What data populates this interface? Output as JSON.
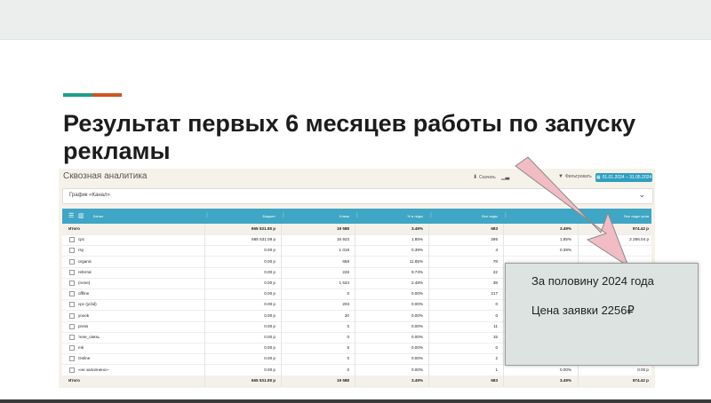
{
  "slide": {
    "title": "Результат первых 6 месяцев работы по запуску рекламы",
    "accent_colors": [
      "#1e9e86",
      "#d0541f"
    ]
  },
  "app": {
    "title": "Сквозная аналитика",
    "toolbar": {
      "download_label": "Скачать",
      "filter_label": "Фильтровать",
      "date_range": "01.01.2024 – 31.05.2024"
    },
    "chart_selector": "График «Канал»",
    "colors": {
      "header": "#3fa6c5",
      "date_button": "#2f9fc0",
      "total_row": "#f3f1ea"
    },
    "columns": [
      "Канал",
      "Бюджет",
      "Клики",
      "% в лиды",
      "Все лиды",
      "",
      "Все лиды цена"
    ],
    "rows": [
      {
        "channel": "Итого",
        "budget": "665 531.08 р",
        "clicks": "19 588",
        "conv": "3.49%",
        "leads": "683",
        "conv2": "3.49%",
        "price": "974.42 р",
        "total": true
      },
      {
        "channel": "cpc",
        "budget": "665 531.08 р",
        "clicks": "15 923",
        "conv": "1.85%",
        "leads": "295",
        "conv2": "1.85%",
        "price": "2 256.04 р"
      },
      {
        "channel": "rsy",
        "budget": "0.00 р",
        "clicks": "1 018",
        "conv": "0.39%",
        "leads": "4",
        "conv2": "0.39%",
        "price": ""
      },
      {
        "channel": "organic",
        "budget": "0.00 р",
        "clicks": "658",
        "conv": "11.85%",
        "leads": "78",
        "conv2": "",
        "price": ""
      },
      {
        "channel": "referral",
        "budget": "0.00 р",
        "clicks": "226",
        "conv": "9.73%",
        "leads": "22",
        "conv2": "",
        "price": ""
      },
      {
        "channel": "(none)",
        "budget": "0.00 р",
        "clicks": "1 534",
        "conv": "2.48%",
        "leads": "38",
        "conv2": "",
        "price": ""
      },
      {
        "channel": "offline",
        "budget": "0.00 р",
        "clicks": "0",
        "conv": "0.00%",
        "leads": "217",
        "conv2": "",
        "price": ""
      },
      {
        "channel": "cpc (yclid)",
        "budget": "0.00 р",
        "clicks": "203",
        "conv": "0.00%",
        "leads": "0",
        "conv2": "",
        "price": ""
      },
      {
        "channel": "yoxok",
        "budget": "0.00 р",
        "clicks": "20",
        "conv": "0.00%",
        "leads": "0",
        "conv2": "",
        "price": ""
      },
      {
        "channel": "press",
        "budget": "0.00 р",
        "clicks": "0",
        "conv": "0.00%",
        "leads": "11",
        "conv2": "",
        "price": ""
      },
      {
        "channel": "теле_связь",
        "budget": "0.00 р",
        "clicks": "0",
        "conv": "0.00%",
        "leads": "15",
        "conv2": "",
        "price": ""
      },
      {
        "channel": "mk",
        "budget": "0.00 р",
        "clicks": "6",
        "conv": "0.00%",
        "leads": "0",
        "conv2": "",
        "price": ""
      },
      {
        "channel": "Online",
        "budget": "0.00 р",
        "clicks": "0",
        "conv": "0.00%",
        "leads": "2",
        "conv2": "",
        "price": ""
      },
      {
        "channel": "«не заполнено»",
        "budget": "0.00 р",
        "clicks": "0",
        "conv": "0.00%",
        "leads": "1",
        "conv2": "0.00%",
        "price": "0.00 р"
      },
      {
        "channel": "Итого",
        "budget": "665 531.08 р",
        "clicks": "19 588",
        "conv": "3.49%",
        "leads": "683",
        "conv2": "3.49%",
        "price": "974.42 р",
        "total": true
      }
    ]
  },
  "callout": {
    "line1": "За половину 2024 года",
    "line2": "Цена заявки 2256₽",
    "arrow_color": "#f2bcc4"
  }
}
